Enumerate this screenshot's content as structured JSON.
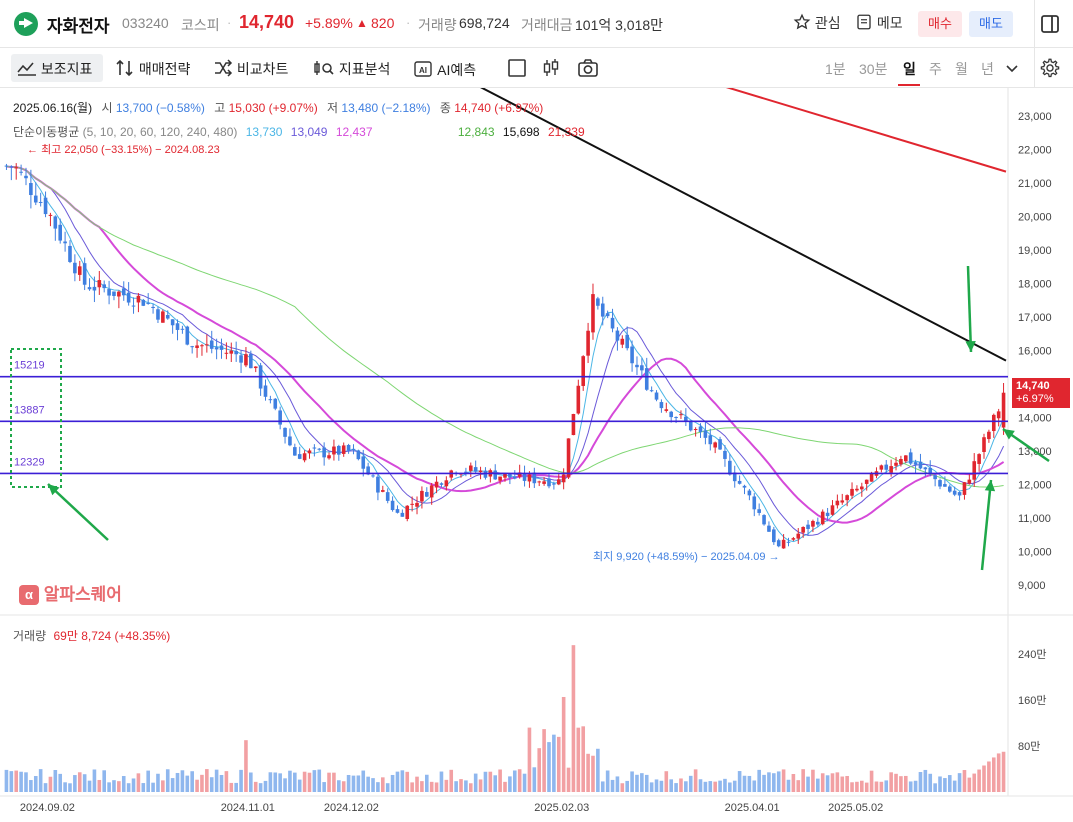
{
  "header": {
    "name": "자화전자",
    "code": "033240",
    "market": "코스피",
    "price": "14,740",
    "change_pct": "+5.89%",
    "change_arrow": "▲",
    "change_abs": "820",
    "volume_label": "거래량",
    "volume": "698,724",
    "amount_label": "거래대금",
    "amount": "101억 3,018만",
    "watch_label": "관심",
    "memo_label": "메모",
    "buy_label": "매수",
    "sell_label": "매도"
  },
  "toolbar": {
    "indicators": "보조지표",
    "strategy": "매매전략",
    "compare": "비교차트",
    "analysis": "지표분석",
    "ai_forecast": "AI예측",
    "periods": [
      "1분",
      "30분",
      "일",
      "주",
      "월",
      "년"
    ],
    "active_period": "일"
  },
  "chart_info": {
    "date_line": "2025.06.16(월)",
    "open_label": "시",
    "open": "13,700 (−0.58%)",
    "high_label": "고",
    "high": "15,030 (+9.07%)",
    "low_label": "저",
    "low": "13,480 (−2.18%)",
    "close_label": "종",
    "close": "14,740 (+6.97%)",
    "ma_label": "단순이동평균",
    "ma_params": "(5, 10, 20, 60, 120, 240, 480)",
    "ma_values": [
      "13,730",
      "13,049",
      "12,437",
      "12,843",
      "15,698",
      "21,339"
    ],
    "max_note": "최고 22,050 (−33.15%) − 2024.08.23",
    "min_note": "최지 9,920 (+48.59%) − 2025.04.09",
    "watermark": "알파스퀘어",
    "price_tag": "14,740",
    "price_tag_pct": "+6.97%",
    "volume_title": "거래량",
    "volume_value": "69만 8,724 (+48.35%)"
  },
  "colors": {
    "up": "#e0262f",
    "down": "#3f7fe0",
    "ma5": "#4bb6e6",
    "ma10": "#6b5ad9",
    "ma20": "#d54ad9",
    "ma60": "#7ed672",
    "ma120": "#111111",
    "ma240": "#e0262f",
    "hline": "#3b1fd6",
    "arrow": "#1fa84a",
    "box": "#1fa84a"
  },
  "chart_data": {
    "type": "candlestick",
    "y_range": [
      8500,
      23600
    ],
    "y_ticks": [
      "23,000",
      "22,000",
      "21,000",
      "20,000",
      "19,000",
      "18,000",
      "17,000",
      "16,000",
      "15,000",
      "14,000",
      "13,000",
      "12,000",
      "11,000",
      "10,000",
      "9,000"
    ],
    "x_ticks": [
      "2024.09.02",
      "2024.11.01",
      "2024.12.02",
      "2025.02.03",
      "2025.04.01",
      "2025.05.02"
    ],
    "horizontal_lines": [
      {
        "label": "15219",
        "value": 15219
      },
      {
        "label": "13887",
        "value": 13887
      },
      {
        "label": "12329",
        "value": 12329
      }
    ],
    "closing_price_keypoints": [
      {
        "date": "2024.08.23",
        "close": 21500
      },
      {
        "date": "2024.09.02",
        "close": 20200
      },
      {
        "date": "2024.09.13",
        "close": 18000
      },
      {
        "date": "2024.10.01",
        "close": 17500
      },
      {
        "date": "2024.10.16",
        "close": 16200
      },
      {
        "date": "2024.11.01",
        "close": 15800
      },
      {
        "date": "2024.11.15",
        "close": 12900
      },
      {
        "date": "2024.12.02",
        "close": 13000
      },
      {
        "date": "2024.12.16",
        "close": 11100
      },
      {
        "date": "2025.01.02",
        "close": 12500
      },
      {
        "date": "2025.01.20",
        "close": 12200
      },
      {
        "date": "2025.02.03",
        "close": 12100
      },
      {
        "date": "2025.02.12",
        "close": 17500
      },
      {
        "date": "2025.03.04",
        "close": 14500
      },
      {
        "date": "2025.03.20",
        "close": 13200
      },
      {
        "date": "2025.04.01",
        "close": 11500
      },
      {
        "date": "2025.04.09",
        "close": 10100
      },
      {
        "date": "2025.05.02",
        "close": 11800
      },
      {
        "date": "2025.05.16",
        "close": 12900
      },
      {
        "date": "2025.06.02",
        "close": 11600
      },
      {
        "date": "2025.06.16",
        "close": 14740
      }
    ],
    "volume_ticks": [
      "240만",
      "160만",
      "80만"
    ],
    "volume_range": [
      0,
      2900000
    ],
    "volume_keypoints": [
      {
        "date": "2024.11.01",
        "volume": 900000
      },
      {
        "date": "2025.02.03",
        "volume": 1650000
      },
      {
        "date": "2025.02.07",
        "volume": 2550000
      },
      {
        "date": "2025.06.16",
        "volume": 698724
      }
    ]
  }
}
